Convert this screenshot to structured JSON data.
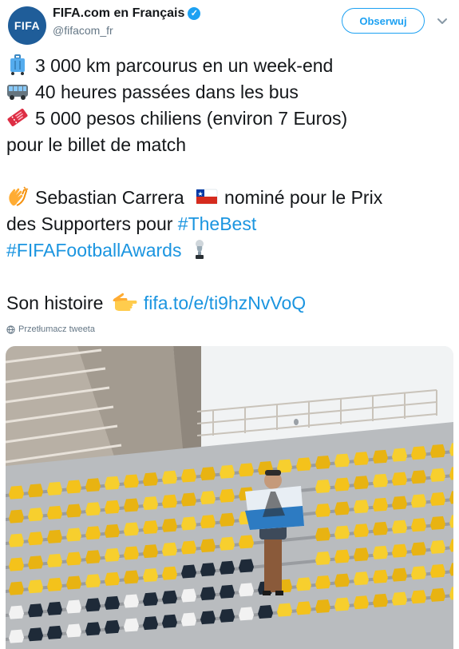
{
  "tweet": {
    "author_name": "FIFA.com en Français",
    "author_handle": "@fifacom_fr",
    "avatar_text": "FIFA",
    "follow_label": "Obserwuj",
    "lines": {
      "l1": "3 000 km parcourus en un week-end",
      "l2": "40 heures passées dans les bus",
      "l3": "5 000 pesos chiliens (environ 7 Euros)",
      "l4": "pour le billet de match",
      "l5a": "Sebastian Carrera",
      "l5b": "nominé pour le Prix",
      "l6a": "des Supporters pour",
      "l6_hashtag": "#TheBest",
      "l7_hashtag": "#FIFAFootballAwards",
      "l8a": "Son histoire",
      "l8_link": "fifa.to/e/ti9hzNvVoQ"
    },
    "translate_label": "Przetłumacz tweeta",
    "icons": {
      "verified": "verified-badge-icon",
      "more": "chevron-down-icon",
      "suitcase": "luggage-emoji-icon",
      "bus": "bus-emoji-icon",
      "ticket": "ticket-emoji-icon",
      "clap": "clapping-hands-emoji-icon",
      "flag": "chile-flag-emoji-icon",
      "trophy": "trophy-emoji-icon",
      "point": "pointing-hand-emoji-icon",
      "globe": "globe-icon"
    },
    "colors": {
      "link": "#1b95e0",
      "follow": "#1da1f2",
      "avatar": "#1f5d99",
      "muted": "#657786"
    }
  },
  "media": {
    "alt": "photo-stadium-supporter"
  }
}
